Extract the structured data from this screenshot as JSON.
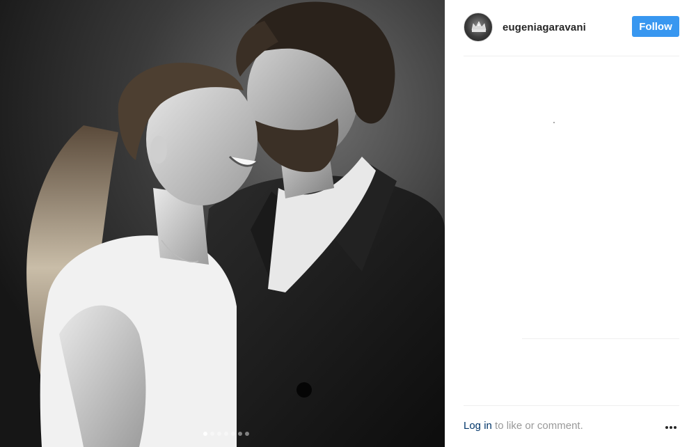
{
  "post": {
    "photo": {
      "alt": "Black and white photo of a smiling couple",
      "carousel_count": 7,
      "carousel_active_index": 0
    },
    "author": {
      "username": "eugeniagaravani",
      "avatar_icon": "crown-avatar-icon"
    },
    "actions": {
      "follow_label": "Follow"
    },
    "footer": {
      "login_link": "Log in",
      "login_suffix": " to like or comment.",
      "more_icon": "more-options-icon"
    }
  },
  "colors": {
    "follow_button": "#3897f0",
    "link": "#003569",
    "muted_text": "#999999",
    "divider": "#efefef"
  }
}
